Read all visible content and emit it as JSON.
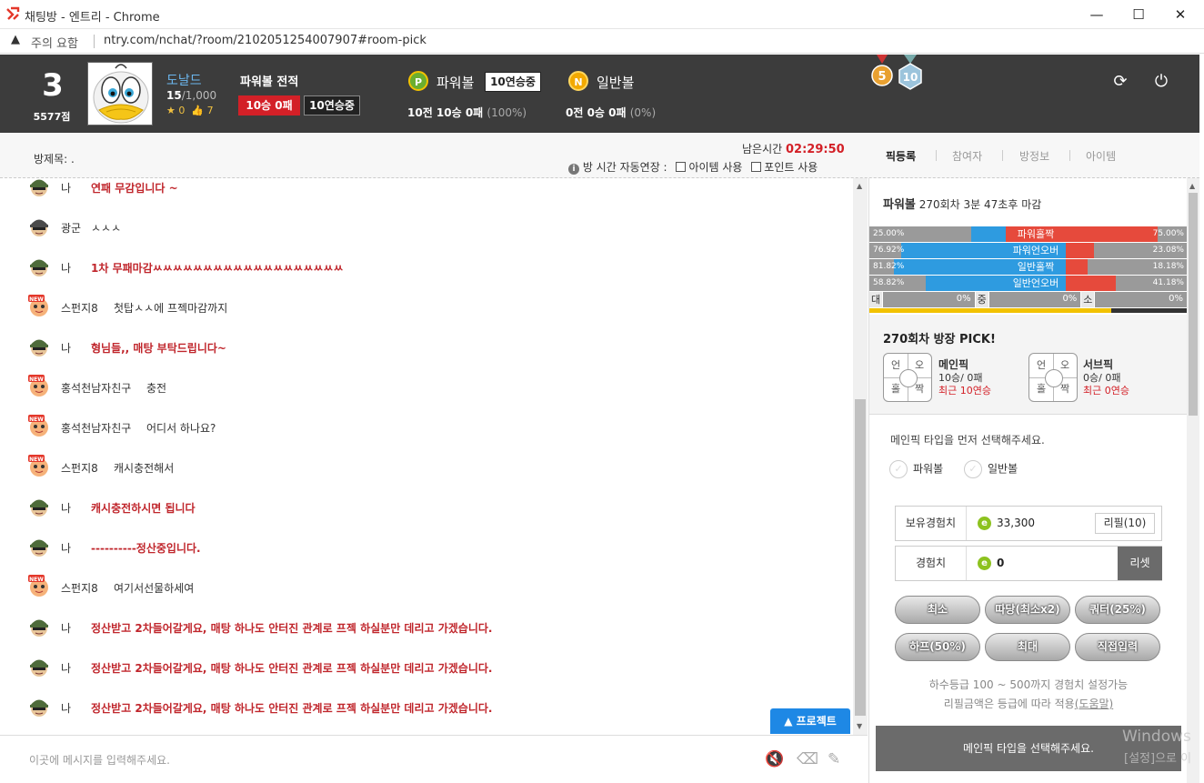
{
  "window": {
    "title": "채팅방 - 엔트리 - Chrome",
    "warning": "주의 요함",
    "url": "ntry.com/nchat/?room/2102051254007907#room-pick",
    "minimize": "—",
    "maximize": "☐",
    "close": "✕"
  },
  "profile": {
    "rank": "3",
    "points": "5577점",
    "nickname": "도날드",
    "exp_current": "15",
    "exp_total": "/1,000",
    "stars": "0",
    "likes": "7"
  },
  "record": {
    "title": "파워볼 전적",
    "winloss": "10승 0패",
    "streak": "10연승중"
  },
  "powerball": {
    "label": "파워볼",
    "ball": "P",
    "streak": "10연승중",
    "stat": "10전 10승 0패",
    "pct": "(100%)"
  },
  "normalball": {
    "label": "일반볼",
    "ball": "N",
    "stat": "0전 0승 0패",
    "pct": "(0%)"
  },
  "medals": [
    "5",
    "10"
  ],
  "room": {
    "title_label": "방제목: .",
    "remain_label": "남은시간",
    "remain_time": "02:29:50",
    "auto_extend": "방 시간 자동연장 :",
    "item_use": "아이템 사용",
    "point_use": "포인트 사용"
  },
  "tabs": [
    "픽등록",
    "참여자",
    "방정보",
    "아이템"
  ],
  "chat": [
    {
      "who": "나",
      "text": "연패 무감입니다 ~",
      "me": true,
      "avatar": "soldier"
    },
    {
      "who": "광군",
      "text": "ㅅㅅㅅ",
      "me": false,
      "avatar": "soldier-dark"
    },
    {
      "who": "나",
      "text": "1차 무패마감ㅆㅆㅆㅆㅆㅆㅆㅆㅆㅆㅆㅆㅆㅆㅆㅆㅆㅆㅆ",
      "me": true,
      "avatar": "soldier"
    },
    {
      "who": "스펀지8",
      "text": "첫탑ㅅㅅ에 프젝마감까지",
      "me": false,
      "avatar": "new"
    },
    {
      "who": "나",
      "text": "형님들,, 매탕 부탁드립니다~",
      "me": true,
      "avatar": "soldier"
    },
    {
      "who": "홍석천남자친구",
      "text": "충전",
      "me": false,
      "avatar": "new"
    },
    {
      "who": "홍석천남자친구",
      "text": "어디서 하나요?",
      "me": false,
      "avatar": "new"
    },
    {
      "who": "스펀지8",
      "text": "캐시충전해서",
      "me": false,
      "avatar": "new"
    },
    {
      "who": "나",
      "text": "캐시충전하시면 됩니다",
      "me": true,
      "avatar": "soldier"
    },
    {
      "who": "나",
      "text": "----------정산중입니다.",
      "me": true,
      "avatar": "soldier"
    },
    {
      "who": "스펀지8",
      "text": "여기서선물하세여",
      "me": false,
      "avatar": "new"
    },
    {
      "who": "나",
      "text": "정산받고 2차들어갈게요, 매탕 하나도 안터진 관계로 프젝 하실분만 데리고 가겠습니다.",
      "me": true,
      "avatar": "soldier"
    },
    {
      "who": "나",
      "text": "정산받고 2차들어갈게요, 매탕 하나도 안터진 관계로 프젝 하실분만 데리고 가겠습니다.",
      "me": true,
      "avatar": "soldier"
    },
    {
      "who": "나",
      "text": "정산받고 2차들어갈게요, 매탕 하나도 안터진 관계로 프젝 하실분만 데리고 가겠습니다.",
      "me": true,
      "avatar": "soldier"
    }
  ],
  "project_button": "▲ 프로젝트",
  "chat_input_placeholder": "이곳에 메시지를 입력해주세요.",
  "round": {
    "name": "파워볼",
    "number": "270회차",
    "remain": "3분 47초후 마감"
  },
  "stats": [
    {
      "left_pct": "25.00%",
      "left": 0.25,
      "label": "파워홀짝",
      "right_pct": "75.00%",
      "right": 0.75,
      "active": "right"
    },
    {
      "left_pct": "76.92%",
      "left": 0.7692,
      "label": "파워언오버",
      "right_pct": "23.08%",
      "right": 0.2308,
      "active": "left"
    },
    {
      "left_pct": "81.82%",
      "left": 0.8182,
      "label": "일반홀짝",
      "right_pct": "18.18%",
      "right": 0.1818,
      "active": "left"
    },
    {
      "left_pct": "58.82%",
      "left": 0.5882,
      "label": "일반언오버",
      "right_pct": "41.18%",
      "right": 0.4118,
      "active": "left"
    }
  ],
  "size_stats": [
    {
      "label": "대",
      "pct": "0%"
    },
    {
      "label": "중",
      "pct": "0%"
    },
    {
      "label": "소",
      "pct": "0%"
    }
  ],
  "time_progress": 0.76,
  "pick": {
    "title": "270회차 방장 PICK!",
    "grid": [
      "언",
      "오",
      "홀",
      "짝"
    ],
    "main": {
      "title": "메인픽",
      "record": "10승/ 0패",
      "recent": "최근 10연승"
    },
    "sub": {
      "title": "서브픽",
      "record": "0승/ 0패",
      "recent": "최근 0연승"
    }
  },
  "form": {
    "guide": "메인픽 타입을 먼저 선택해주세요.",
    "type1": "파워볼",
    "type2": "일반볼",
    "owned_label": "보유경험치",
    "owned_value": "33,300",
    "refill": "리필(10)",
    "exp_label": "경험치",
    "exp_value": "0",
    "reset": "리셋",
    "buttons": [
      "최소",
      "따당(최소x2)",
      "쿼터(25%)",
      "하프(50%)",
      "최대",
      "직접입력"
    ],
    "hint1": "하수등급 100 ~ 500까지 경험치 설정가능",
    "hint2_pre": "리필금액은 등급에 따라 적용",
    "hint2_link": "(도움말)",
    "submit": "메인픽 타입을 선택해주세요."
  },
  "watermark": {
    "line1": "Windows",
    "line2": "[설정]으로 이"
  }
}
